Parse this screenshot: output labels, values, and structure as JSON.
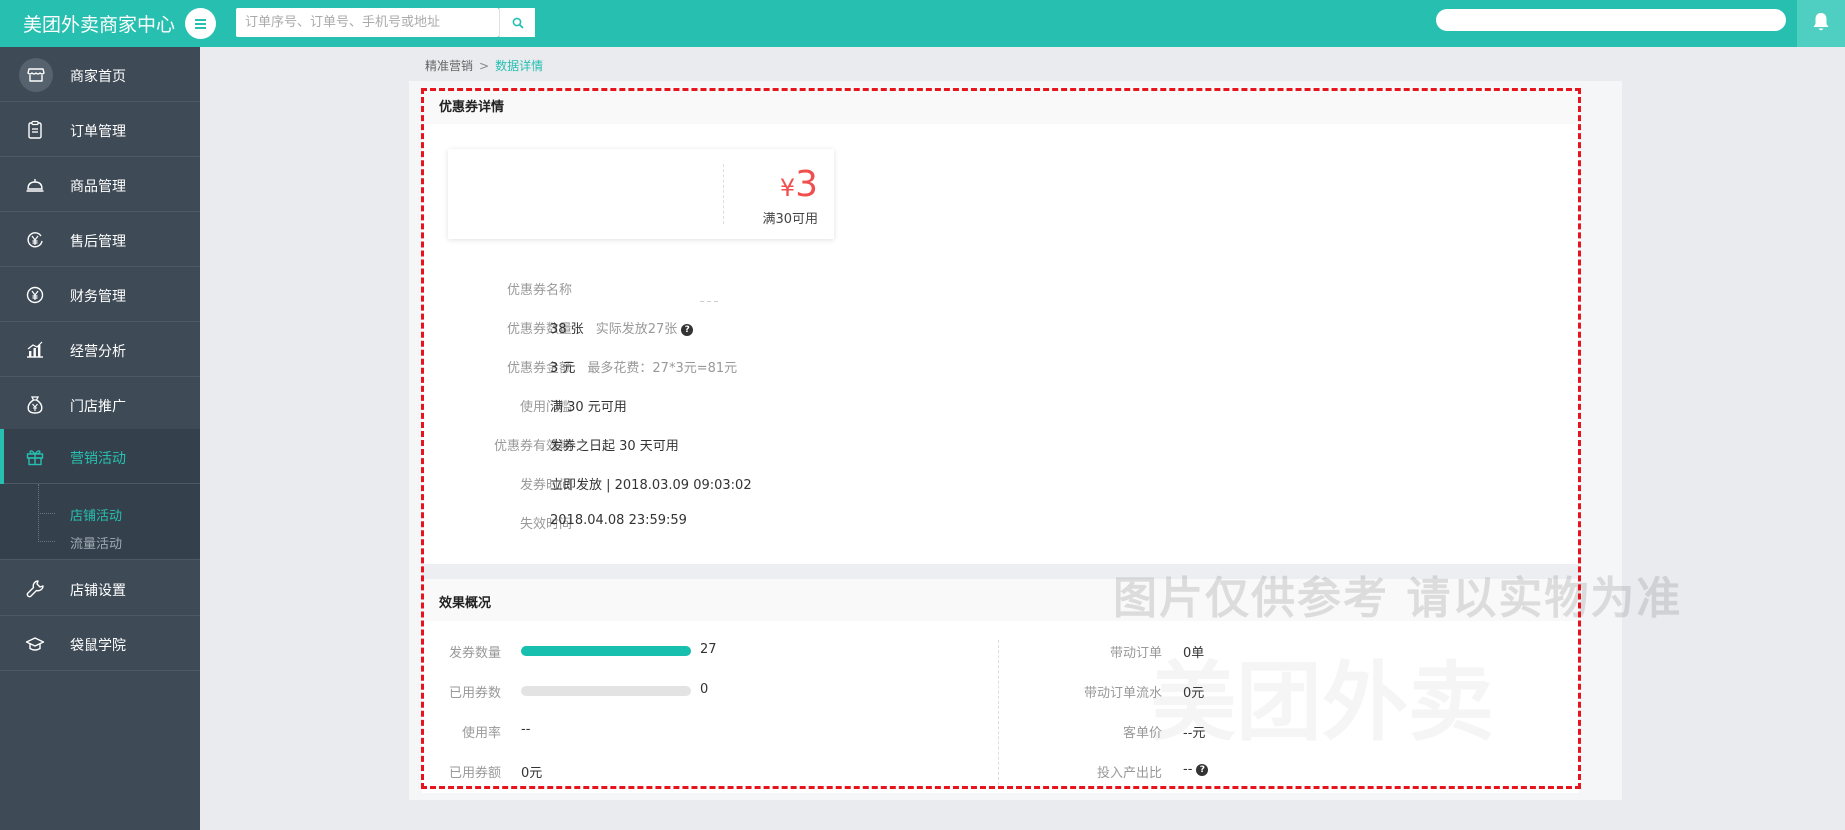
{
  "app": {
    "title": "美团外卖商家中心",
    "search_placeholder": "订单序号、订单号、手机号或地址",
    "top_right_field_value": ""
  },
  "sidebar": {
    "items": [
      {
        "label": "商家首页",
        "icon": "store-icon"
      },
      {
        "label": "订单管理",
        "icon": "clipboard-icon"
      },
      {
        "label": "商品管理",
        "icon": "food-cloche-icon"
      },
      {
        "label": "售后管理",
        "icon": "yen-circle-icon"
      },
      {
        "label": "财务管理",
        "icon": "yen-coin-icon"
      },
      {
        "label": "经营分析",
        "icon": "bar-chart-icon"
      },
      {
        "label": "门店推广",
        "icon": "money-bag-icon"
      },
      {
        "label": "营销活动",
        "icon": "gift-icon"
      },
      {
        "label": "店铺设置",
        "icon": "wrench-icon"
      },
      {
        "label": "袋鼠学院",
        "icon": "graduation-cap-icon"
      }
    ],
    "active_index": 7,
    "sub_items": [
      {
        "label": "店铺活动",
        "active": true
      },
      {
        "label": "流量活动",
        "active": false
      }
    ]
  },
  "breadcrumb": {
    "parent": "精准营销",
    "separator": ">",
    "current": "数据详情"
  },
  "coupon_detail": {
    "section_title": "优惠券详情",
    "coupon": {
      "currency": "¥",
      "amount": "3",
      "condition": "满30可用"
    },
    "rows": [
      {
        "label": "优惠券名称",
        "value": "",
        "note": ""
      },
      {
        "label": "优惠券数量",
        "value": "38 张",
        "note": "实际发放27张",
        "help": true
      },
      {
        "label": "优惠券金额",
        "value": "3 元",
        "note": "最多花费：27*3元=81元"
      },
      {
        "label": "使用门槛",
        "value": "满 30 元可用",
        "note": ""
      },
      {
        "label": "优惠券有效期",
        "value": "发券之日起 30 天可用",
        "note": ""
      },
      {
        "label": "发券时间",
        "value": "立即发放 | 2018.03.09 09:03:02",
        "note": ""
      },
      {
        "label": "失效时间",
        "value": "2018.04.08 23:59:59",
        "note": ""
      }
    ]
  },
  "effect_overview": {
    "section_title": "效果概况",
    "left": [
      {
        "label": "发券数量",
        "value": "27",
        "progress": 1.0
      },
      {
        "label": "已用券数",
        "value": "0",
        "progress": 0.0
      },
      {
        "label": "使用率",
        "value": "--"
      },
      {
        "label": "已用券额",
        "value": "0元"
      }
    ],
    "right": [
      {
        "label": "带动订单",
        "value": "0单"
      },
      {
        "label": "带动订单流水",
        "value": "0元"
      },
      {
        "label": "客单价",
        "value": "--元"
      },
      {
        "label": "投入产出比",
        "value": "--",
        "help": true
      }
    ]
  },
  "watermark": {
    "line1": "图片仅供参考 请以实物为准",
    "line2": "美团外卖"
  },
  "colors": {
    "brand": "#27c0b0",
    "sidebar": "#3e4a55",
    "price": "#f14e4e",
    "annotation": "#e8141d"
  }
}
